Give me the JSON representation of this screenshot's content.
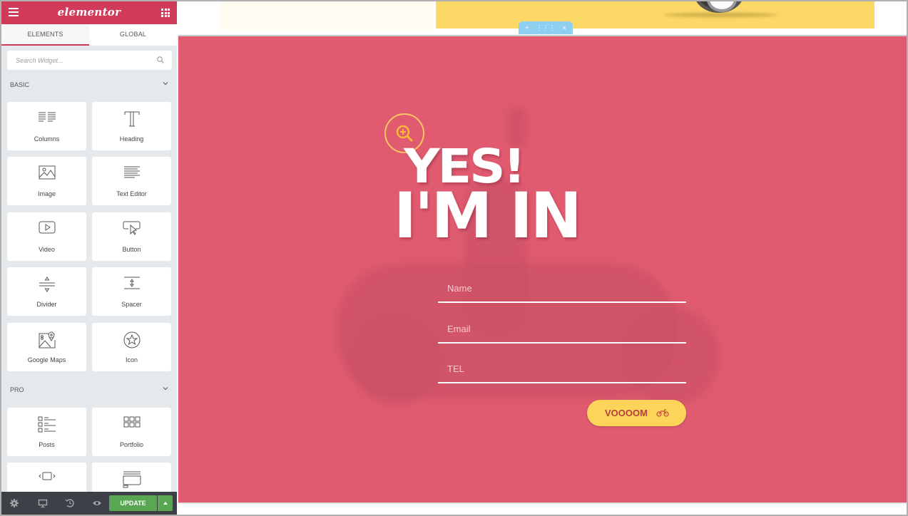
{
  "app": {
    "logo": "elementor",
    "tabs": [
      {
        "label": "ELEMENTS",
        "active": true
      },
      {
        "label": "GLOBAL",
        "active": false
      }
    ],
    "search": {
      "placeholder": "Search Widget...",
      "value": ""
    },
    "categories": [
      {
        "label": "BASIC",
        "widgets": [
          {
            "label": "Columns",
            "icon": "columns-icon"
          },
          {
            "label": "Heading",
            "icon": "heading-icon"
          },
          {
            "label": "Image",
            "icon": "image-icon"
          },
          {
            "label": "Text Editor",
            "icon": "text-editor-icon"
          },
          {
            "label": "Video",
            "icon": "video-icon"
          },
          {
            "label": "Button",
            "icon": "button-icon"
          },
          {
            "label": "Divider",
            "icon": "divider-icon"
          },
          {
            "label": "Spacer",
            "icon": "spacer-icon"
          },
          {
            "label": "Google Maps",
            "icon": "google-maps-icon"
          },
          {
            "label": "Icon",
            "icon": "star-icon"
          }
        ]
      },
      {
        "label": "PRO",
        "widgets": [
          {
            "label": "Posts",
            "icon": "posts-icon"
          },
          {
            "label": "Portfolio",
            "icon": "portfolio-icon"
          },
          {
            "label": "",
            "icon": "slides-icon"
          },
          {
            "label": "",
            "icon": "form-icon"
          }
        ]
      }
    ],
    "footer": {
      "icons": [
        "settings-icon",
        "responsive-icon",
        "history-icon",
        "preview-icon"
      ],
      "update_label": "UPDATE"
    }
  },
  "canvas": {
    "section_handle": {
      "add": "+",
      "move": "⋮⋮⋮",
      "delete": "×"
    },
    "headline_line1": "YES!",
    "headline_line2": "I'M IN",
    "form": {
      "fields": [
        {
          "placeholder": "Name",
          "value": ""
        },
        {
          "placeholder": "Email",
          "value": ""
        },
        {
          "placeholder": "TEL",
          "value": ""
        }
      ],
      "submit_label": "VOOOOM",
      "submit_icon": "motorcycle-icon"
    }
  },
  "colors": {
    "brand": "#d03b5a",
    "section_bg": "#e05b70",
    "accent_yellow": "#fcd45a",
    "update_green": "#59a752",
    "handle_blue": "#8fd0f0"
  }
}
